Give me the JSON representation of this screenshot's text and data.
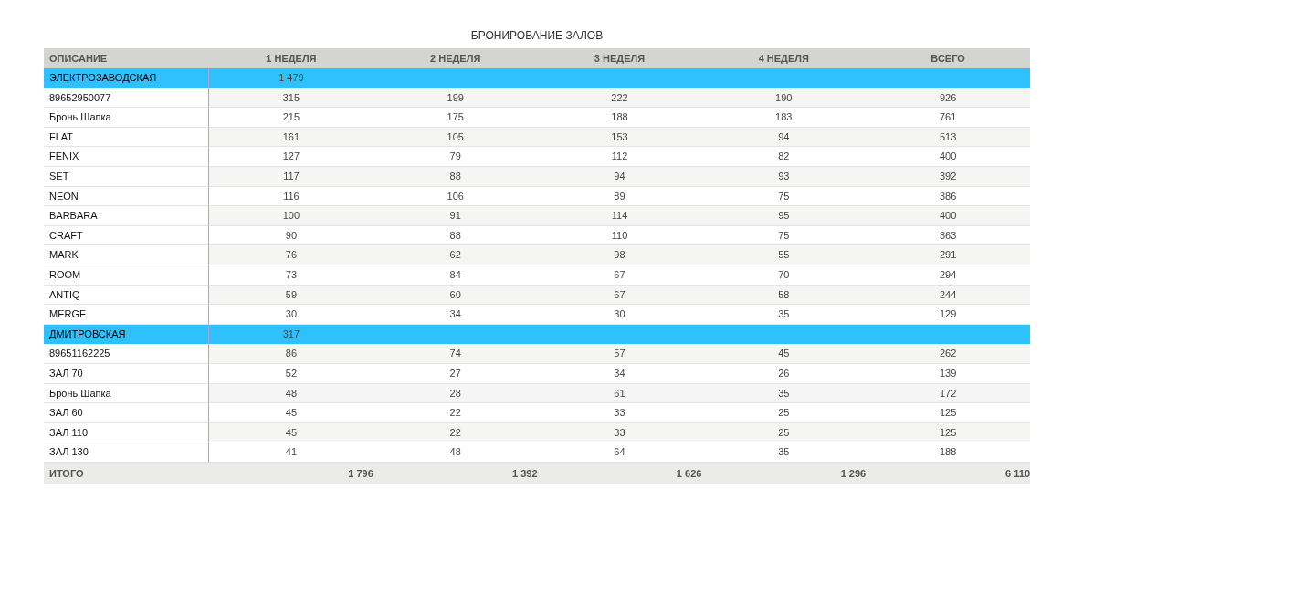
{
  "title": "БРОНИРОВАНИЕ ЗАЛОВ",
  "columns": [
    "ОПИСАНИЕ",
    "1 НЕДЕЛЯ",
    "2 НЕДЕЛЯ",
    "3 НЕДЕЛЯ",
    "4 НЕДЕЛЯ",
    "ВСЕГО"
  ],
  "rows": [
    {
      "kind": "group",
      "label": "ЭЛЕКТРОЗАВОДСКАЯ",
      "values": [
        "1 479"
      ]
    },
    {
      "kind": "item",
      "label": "89652950077",
      "values": [
        "315",
        "199",
        "222",
        "190",
        "926"
      ]
    },
    {
      "kind": "item",
      "label": "Бронь Шапка",
      "values": [
        "215",
        "175",
        "188",
        "183",
        "761"
      ]
    },
    {
      "kind": "item",
      "label": "FLAT",
      "values": [
        "161",
        "105",
        "153",
        "94",
        "513"
      ]
    },
    {
      "kind": "item",
      "label": "FENIX",
      "values": [
        "127",
        "79",
        "112",
        "82",
        "400"
      ]
    },
    {
      "kind": "item",
      "label": "SET",
      "values": [
        "117",
        "88",
        "94",
        "93",
        "392"
      ]
    },
    {
      "kind": "item",
      "label": "NEON",
      "values": [
        "116",
        "106",
        "89",
        "75",
        "386"
      ]
    },
    {
      "kind": "item",
      "label": "BARBARA",
      "values": [
        "100",
        "91",
        "114",
        "95",
        "400"
      ]
    },
    {
      "kind": "item",
      "label": "CRAFT",
      "values": [
        "90",
        "88",
        "110",
        "75",
        "363"
      ]
    },
    {
      "kind": "item",
      "label": "MARK",
      "values": [
        "76",
        "62",
        "98",
        "55",
        "291"
      ]
    },
    {
      "kind": "item",
      "label": "ROOM",
      "values": [
        "73",
        "84",
        "67",
        "70",
        "294"
      ]
    },
    {
      "kind": "item",
      "label": "ANTIQ",
      "values": [
        "59",
        "60",
        "67",
        "58",
        "244"
      ]
    },
    {
      "kind": "item",
      "label": "MERGE",
      "values": [
        "30",
        "34",
        "30",
        "35",
        "129"
      ]
    },
    {
      "kind": "group",
      "label": "ДМИТРОВСКАЯ",
      "values": [
        "317"
      ]
    },
    {
      "kind": "item",
      "label": "89651162225",
      "values": [
        "86",
        "74",
        "57",
        "45",
        "262"
      ]
    },
    {
      "kind": "item",
      "label": "ЗАЛ 70",
      "values": [
        "52",
        "27",
        "34",
        "26",
        "139"
      ]
    },
    {
      "kind": "item",
      "label": "Бронь Шапка",
      "values": [
        "48",
        "28",
        "61",
        "35",
        "172"
      ]
    },
    {
      "kind": "item",
      "label": "ЗАЛ 60",
      "values": [
        "45",
        "22",
        "33",
        "25",
        "125"
      ]
    },
    {
      "kind": "item",
      "label": "ЗАЛ 110",
      "values": [
        "45",
        "22",
        "33",
        "25",
        "125"
      ]
    },
    {
      "kind": "item",
      "label": "ЗАЛ 130",
      "values": [
        "41",
        "48",
        "64",
        "35",
        "188"
      ]
    }
  ],
  "total": {
    "label": "ИТОГО",
    "values": [
      "1 796",
      "1 392",
      "1 626",
      "1 296",
      "6 110"
    ]
  }
}
